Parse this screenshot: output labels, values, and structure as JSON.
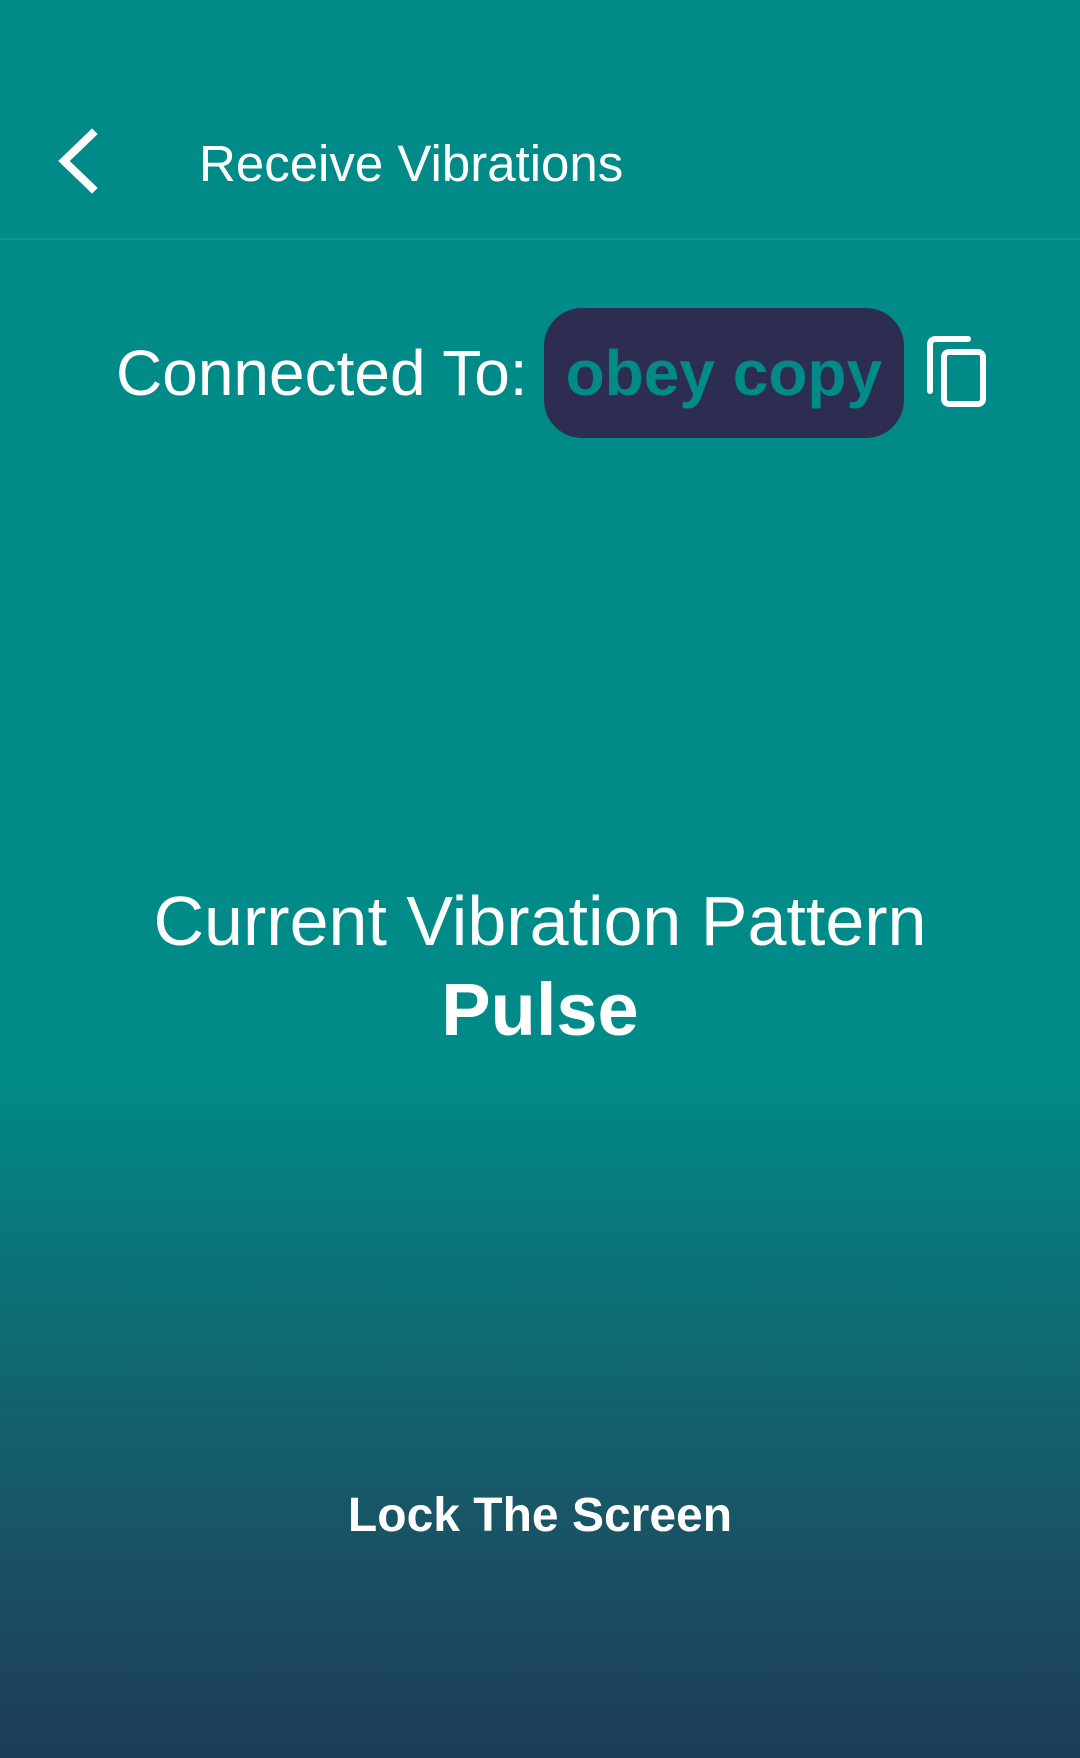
{
  "header": {
    "title": "Receive Vibrations",
    "back_icon": "chevron-left-icon"
  },
  "connection": {
    "label": "Connected To:",
    "device_name": "obey copy",
    "copy_icon": "copy-icon"
  },
  "pattern": {
    "title": "Current Vibration Pattern",
    "name": "Pulse"
  },
  "actions": {
    "lock_label": "Lock The Screen"
  },
  "colors": {
    "background_top": "#008b88",
    "background_bottom": "#1d3d57",
    "chip_background": "#2d2d52",
    "chip_text": "#008b88",
    "text": "#ffffff"
  }
}
